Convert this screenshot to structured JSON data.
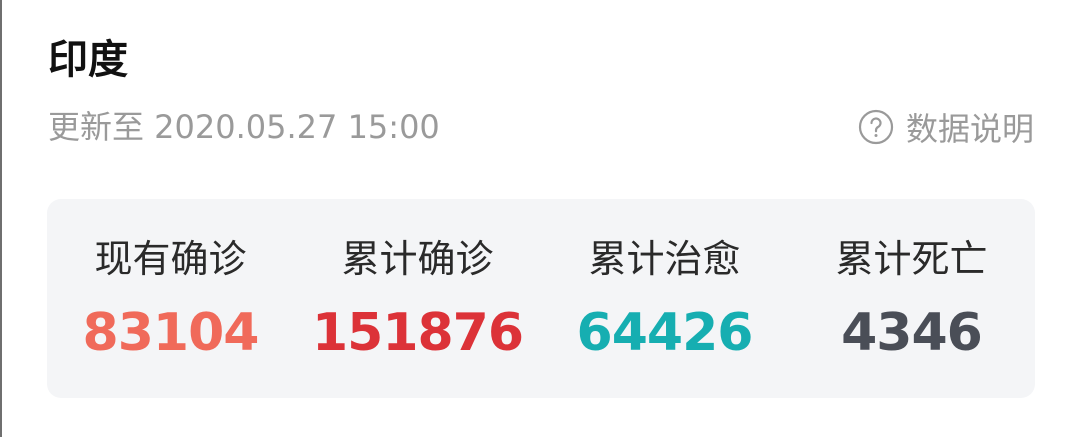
{
  "header": {
    "title": "印度",
    "update_time": "更新至 2020.05.27 15:00",
    "data_explain_label": "数据说明",
    "data_explain_icon": "question-circle-icon"
  },
  "stats": [
    {
      "label": "现有确诊",
      "value": "83104",
      "color": "#f06a5a"
    },
    {
      "label": "累计确诊",
      "value": "151876",
      "color": "#dc3238"
    },
    {
      "label": "累计治愈",
      "value": "64426",
      "color": "#16aeb1"
    },
    {
      "label": "累计死亡",
      "value": "4346",
      "color": "#4a4e57"
    }
  ]
}
